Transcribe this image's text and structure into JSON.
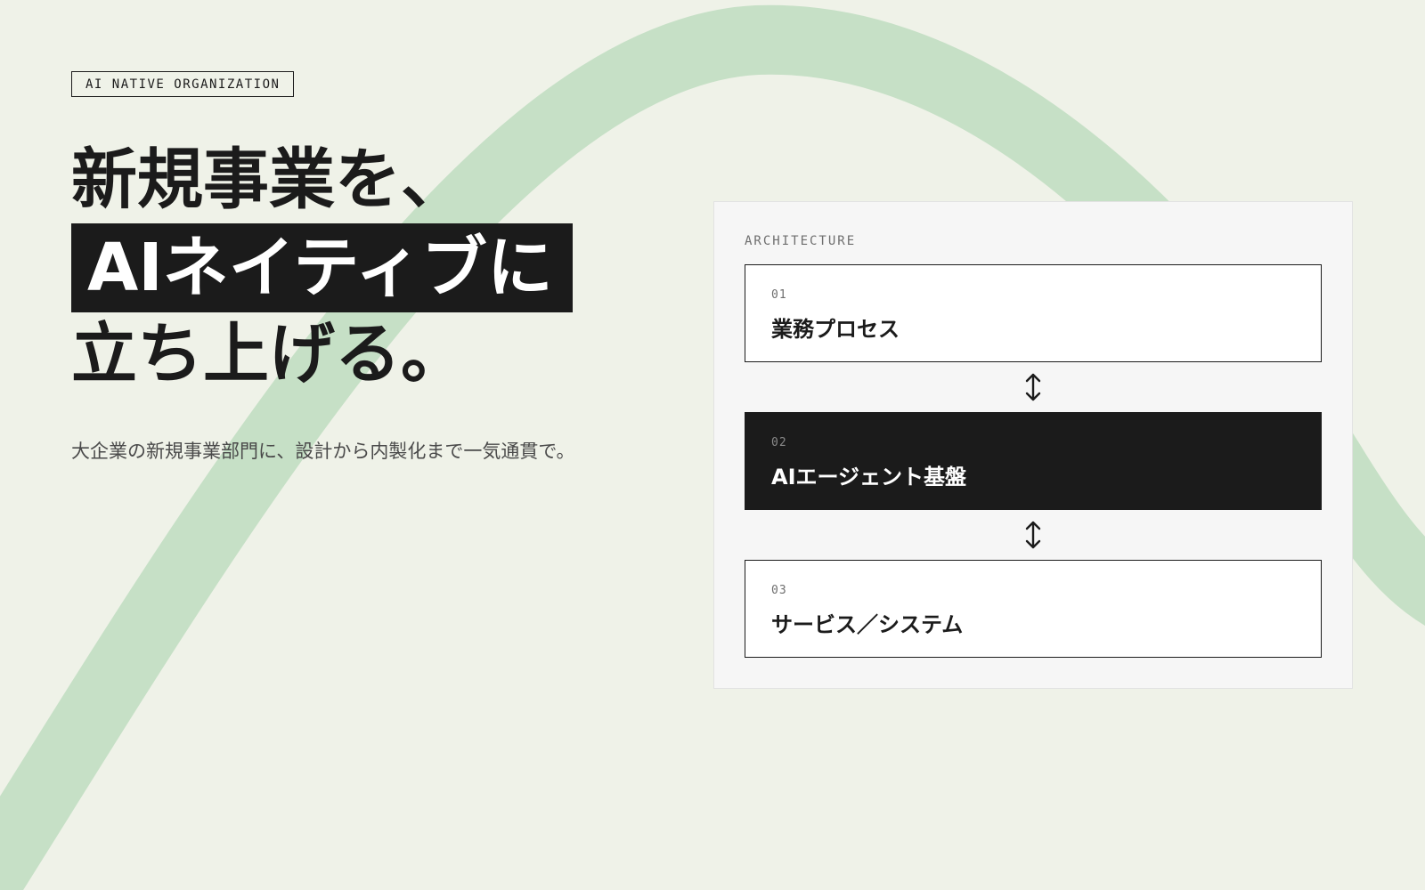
{
  "tag": {
    "label": "AI NATIVE ORGANIZATION"
  },
  "headline": {
    "line1": "新規事業を、",
    "highlight": "AIネイティブに",
    "line3": "立ち上げる。"
  },
  "subtitle": "大企業の新規事業部門に、設計から内製化まで一気通貫で。",
  "architecture": {
    "label": "ARCHITECTURE",
    "layers": [
      {
        "number": "01",
        "name": "業務プロセス"
      },
      {
        "number": "02",
        "name": "AIエージェント基盤"
      },
      {
        "number": "03",
        "name": "サービス／システム"
      }
    ],
    "connector_icon": "bidirectional-vertical-arrow-icon"
  },
  "colors": {
    "background": "#EFF2E8",
    "accent_curve": "#C6E0C6",
    "ink": "#1B1B1B",
    "panel": "#F6F6F6",
    "card": "#FFFFFF"
  }
}
